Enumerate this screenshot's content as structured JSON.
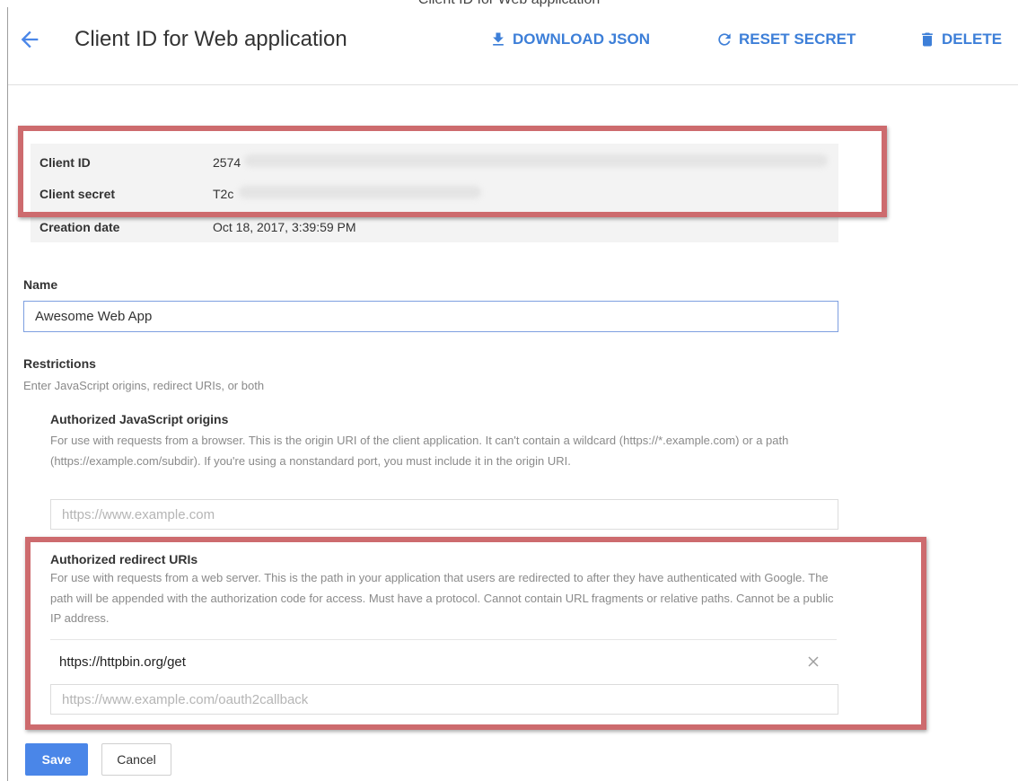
{
  "header": {
    "top_sliver": "Client ID for Web application",
    "title": "Client ID for Web application",
    "download_label": "DOWNLOAD JSON",
    "reset_label": "RESET SECRET",
    "delete_label": "DELETE"
  },
  "info": {
    "client_id_label": "Client ID",
    "client_id_value": "2574",
    "client_secret_label": "Client secret",
    "client_secret_value": "T2c",
    "creation_date_label": "Creation date",
    "creation_date_value": "Oct 18, 2017, 3:39:59 PM"
  },
  "name": {
    "label": "Name",
    "value": "Awesome Web App"
  },
  "restrictions": {
    "label": "Restrictions",
    "subtitle": "Enter JavaScript origins, redirect URIs, or both"
  },
  "js_origins": {
    "label": "Authorized JavaScript origins",
    "help": "For use with requests from a browser. This is the origin URI of the client application. It can't contain a wildcard (https://*.example.com) or a path (https://example.com/subdir). If you're using a nonstandard port, you must include it in the origin URI.",
    "placeholder": "https://www.example.com"
  },
  "redirect_uris": {
    "label": "Authorized redirect URIs",
    "help": "For use with requests from a web server. This is the path in your application that users are redirected to after they have authenticated with Google. The path will be appended with the authorization code for access. Must have a protocol. Cannot contain URL fragments or relative paths. Cannot be a public IP address.",
    "items": [
      "https://httpbin.org/get"
    ],
    "placeholder": "https://www.example.com/oauth2callback"
  },
  "actions": {
    "save_label": "Save",
    "cancel_label": "Cancel"
  },
  "colors": {
    "accent": "#3d7fd8",
    "save_button": "#4a86e8",
    "highlight_box": "#cd6b6e"
  }
}
